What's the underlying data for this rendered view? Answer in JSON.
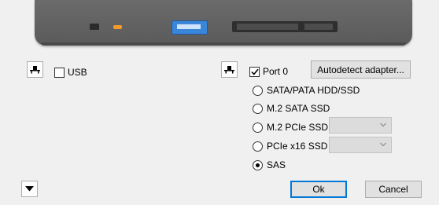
{
  "left": {
    "usb_label": "USB",
    "usb_checked": false
  },
  "right": {
    "port_label": "Port 0",
    "port_checked": true,
    "autodetect_label": "Autodetect adapter...",
    "options": [
      {
        "label": "SATA/PATA HDD/SSD",
        "selected": false
      },
      {
        "label": "M.2 SATA SSD",
        "selected": false
      },
      {
        "label": "M.2 PCIe SSD",
        "selected": false,
        "has_dropdown": true,
        "dropdown_value": ""
      },
      {
        "label": "PCIe x16 SSD",
        "selected": false,
        "has_dropdown": true,
        "dropdown_value": ""
      },
      {
        "label": "SAS",
        "selected": true
      }
    ]
  },
  "footer": {
    "ok_label": "Ok",
    "cancel_label": "Cancel"
  },
  "colors": {
    "device_body": "#5f5f5f",
    "usb_port": "#3a86d9",
    "led": "#f39a2b",
    "accent": "#0078d7"
  },
  "icons": {
    "connector": "port-connector-icon",
    "expand": "expand-down-icon"
  }
}
